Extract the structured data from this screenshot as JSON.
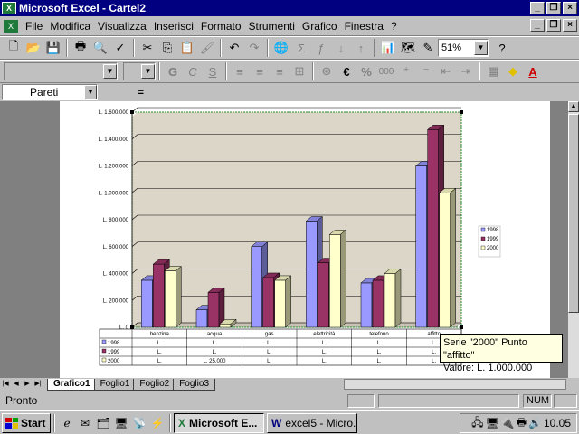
{
  "app": {
    "title": "Microsoft Excel - Cartel2",
    "window_buttons": [
      "_",
      "❐",
      "×"
    ],
    "doc_buttons": [
      "_",
      "❐",
      "×"
    ]
  },
  "menu": [
    "File",
    "Modifica",
    "Visualizza",
    "Inserisci",
    "Formato",
    "Strumenti",
    "Grafico",
    "Finestra",
    "?"
  ],
  "toolbar": {
    "zoom": "51%",
    "standard_icons": [
      "new-icon",
      "open-icon",
      "save-icon",
      "print-icon",
      "print-preview-icon",
      "spelling-icon",
      "cut-icon",
      "copy-icon",
      "paste-icon",
      "format-painter-icon",
      "undo-icon",
      "redo-icon",
      "hyperlink-icon",
      "autosum-icon",
      "function-icon",
      "sort-ascending-icon",
      "sort-descending-icon",
      "chart-wizard-icon",
      "map-icon",
      "drawing-icon",
      "help-icon"
    ]
  },
  "formatting": {
    "font_combo": "",
    "size_combo": "",
    "bold": "G",
    "italic": "C",
    "underline": "S",
    "currency": "€",
    "percent": "%",
    "thousands": "000"
  },
  "formula_bar": {
    "name_box": "Pareti",
    "equals": "="
  },
  "chart_data": {
    "type": "bar",
    "title": "",
    "categories": [
      "benzina",
      "acqua",
      "gas",
      "elettricità",
      "telefono",
      "affitto"
    ],
    "y_ticks": [
      "L. 0",
      "L. 200.000",
      "L. 400.000",
      "L. 600.000",
      "L. 800.000",
      "L. 1.000.000",
      "L. 1.200.000",
      "L. 1.400.000",
      "L. 1.600.000"
    ],
    "ylim": [
      0,
      1600000
    ],
    "series": [
      {
        "name": "1998",
        "values": [
          350000,
          130000,
          600000,
          790000,
          330000,
          1200000
        ],
        "color": "#9999ff"
      },
      {
        "name": "1999",
        "values": [
          470000,
          260000,
          370000,
          480000,
          350000,
          1470000
        ],
        "color": "#993366"
      },
      {
        "name": "2000",
        "values": [
          420000,
          25000,
          350000,
          690000,
          400000,
          1000000
        ],
        "color": "#ffffcc"
      }
    ],
    "legend_position": "right",
    "grid": true,
    "data_table": {
      "rows": [
        {
          "label": "1998",
          "cells": [
            "L.",
            "L.",
            "L.",
            "L.",
            "L.",
            "L."
          ]
        },
        {
          "label": "1999",
          "cells": [
            "L.",
            "L.",
            "L.",
            "L.",
            "L.",
            "L."
          ]
        },
        {
          "label": "2000",
          "cells": [
            "L.",
            "L. 25.000",
            "L.",
            "L.",
            "L.",
            "L."
          ]
        }
      ]
    }
  },
  "tooltip": {
    "line1": "Serie \"2000\" Punto \"affitto\"",
    "line2": "Valore: L. 1.000.000"
  },
  "tabs": [
    "Grafico1",
    "Foglio1",
    "Foglio2",
    "Foglio3"
  ],
  "status": {
    "text": "Pronto",
    "num": "NUM"
  },
  "taskbar": {
    "start": "Start",
    "tasks": [
      "Microsoft E...",
      "excel5 - Micro..."
    ],
    "clock": "10.05"
  }
}
